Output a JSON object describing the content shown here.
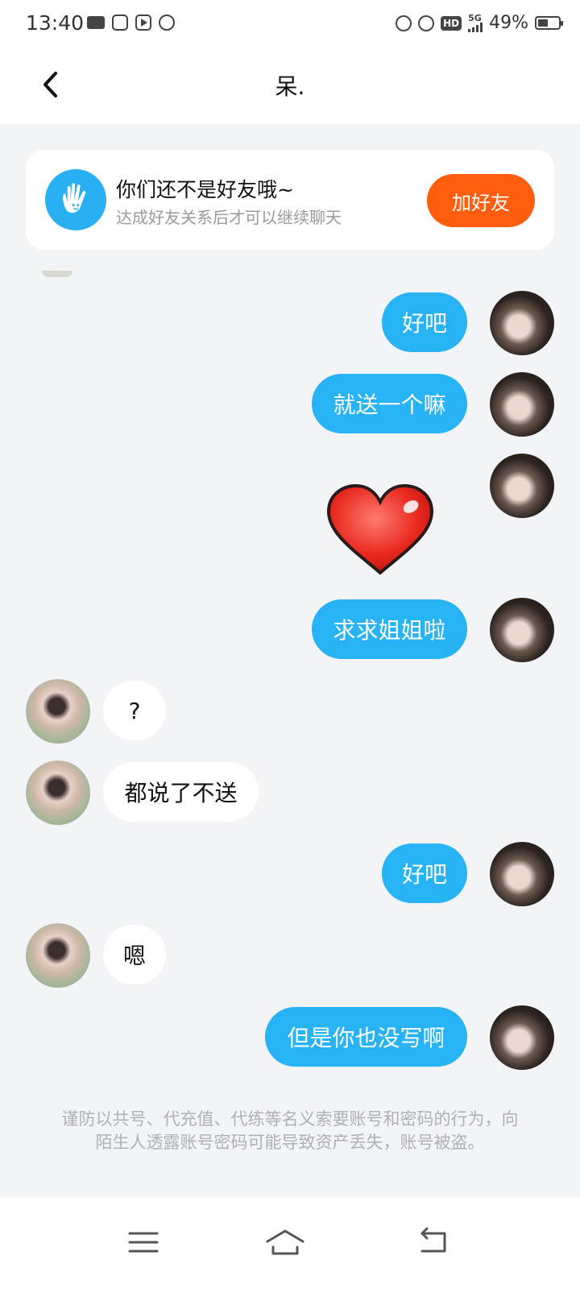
{
  "status_bar": {
    "time": "13:40",
    "network": "5G",
    "hd": "HD",
    "battery_text": "49%",
    "battery_level": 0.49
  },
  "header": {
    "title": "呆."
  },
  "friend_card": {
    "title": "你们还不是好友哦~",
    "subtitle": "达成好友关系后才可以继续聊天",
    "button": "加好友"
  },
  "messages": [
    {
      "from": "me",
      "type": "text",
      "text": "好吧"
    },
    {
      "from": "me",
      "type": "text",
      "text": "就送一个嘛"
    },
    {
      "from": "me",
      "type": "sticker",
      "sticker": "red-heart"
    },
    {
      "from": "me",
      "type": "text",
      "text": "求求姐姐啦"
    },
    {
      "from": "other",
      "type": "text",
      "text": "?"
    },
    {
      "from": "other",
      "type": "text",
      "text": "都说了不送"
    },
    {
      "from": "me",
      "type": "text",
      "text": "好吧"
    },
    {
      "from": "other",
      "type": "text",
      "text": "嗯"
    },
    {
      "from": "me",
      "type": "text",
      "text": "但是你也没写啊"
    }
  ],
  "warning": "谨防以共号、代充值、代练等名义索要账号和密码的行为，向陌生人透露账号密码可能导致资产丢失，账号被盗。",
  "colors": {
    "accent": "#27b3f5",
    "add_friend_button": "#ff5e0e",
    "background": "#f3f4f8"
  },
  "nav_icons": [
    "menu-icon",
    "home-icon",
    "back-icon"
  ]
}
